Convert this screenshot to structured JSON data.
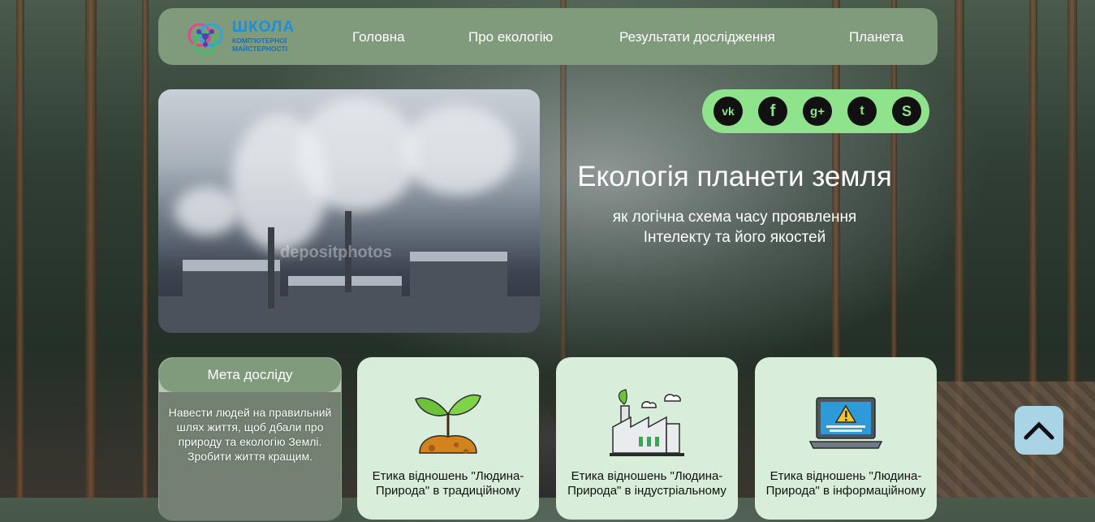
{
  "logo": {
    "title": "ШКОЛА",
    "subtitle": "КОМП'ЮТЕРНОЇ МАЙСТЕРНОСТІ"
  },
  "nav": {
    "items": [
      "Головна",
      "Про екологію",
      "Результати дослідження",
      "Планета"
    ]
  },
  "hero": {
    "watermark": "depositphotos",
    "title": "Екологія планети земля",
    "subtitle": "як логічна схема часу проявлення Інтелекту та його якостей"
  },
  "social": {
    "icons": [
      "vk-icon",
      "facebook-icon",
      "google-plus-icon",
      "twitter-icon",
      "skype-icon"
    ],
    "glyphs": [
      "vk",
      "f",
      "g+",
      "t",
      "S"
    ]
  },
  "goal": {
    "title": "Мета досліду",
    "text": "Навести людей на правильний шлях життя, щоб дбали про природу та екологію Землі. Зробити життя кращим."
  },
  "cards": [
    {
      "text": "Етика відношень \"Людина-Природа\" в традиційному"
    },
    {
      "text": "Етика відношень \"Людина-Природа\" в індустріальному"
    },
    {
      "text": "Етика відношень \"Людина-Природа\" в інформаційному"
    }
  ],
  "colors": {
    "nav": "#7f9b7c",
    "social": "#8fe38c",
    "card": "#d9eeda",
    "up": "#a8d4e6"
  }
}
